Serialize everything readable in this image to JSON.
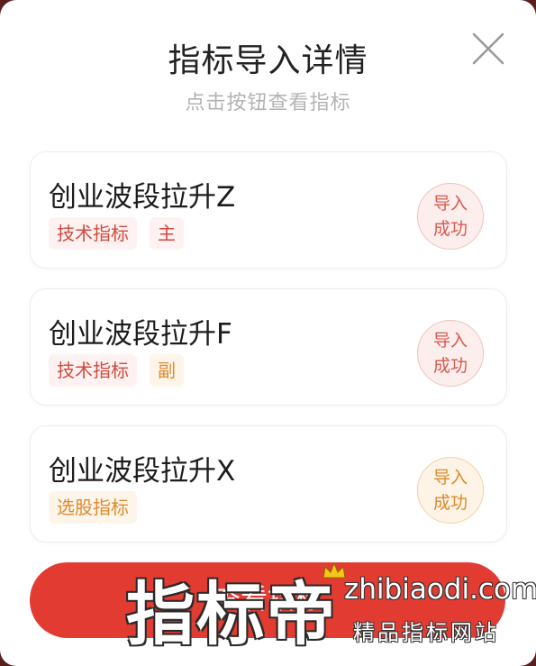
{
  "dialog": {
    "title": "指标导入详情",
    "subtitle": "点击按钮查看指标",
    "close_icon": "close-icon"
  },
  "cards": [
    {
      "name": "创业波段拉升Z",
      "tags": [
        "技术指标",
        "主"
      ],
      "status_line1": "导入",
      "status_line2": "成功"
    },
    {
      "name": "创业波段拉升F",
      "tags": [
        "技术指标",
        "副"
      ],
      "status_line1": "导入",
      "status_line2": "成功"
    },
    {
      "name": "创业波段拉升X",
      "tags": [
        "选股指标"
      ],
      "status_line1": "导入",
      "status_line2": "成功"
    }
  ],
  "button": {
    "label": "查看指标"
  },
  "watermark": {
    "logo": "指标帝",
    "url": "zhibiaodi.com",
    "slogan": "精品指标网站"
  },
  "colors": {
    "accent_red": "#e23b31",
    "tag_red": "#d24a3d",
    "tag_orange": "#e08a2b"
  }
}
